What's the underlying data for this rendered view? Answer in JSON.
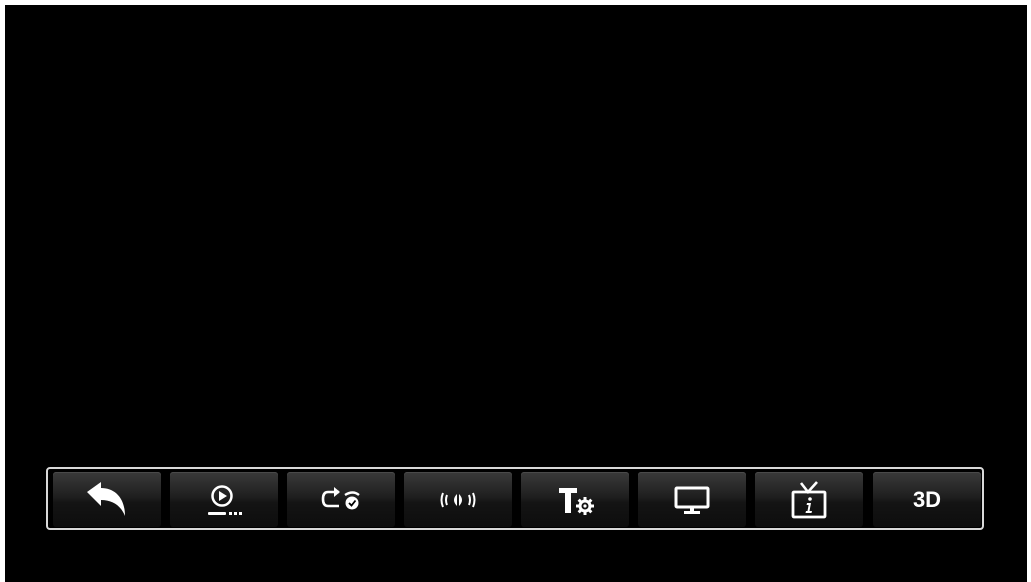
{
  "toolbar": {
    "buttons": [
      {
        "id": "back",
        "icon": "back-arrow-icon"
      },
      {
        "id": "play-mode",
        "icon": "play-progress-icon"
      },
      {
        "id": "repeat",
        "icon": "repeat-icon"
      },
      {
        "id": "audio",
        "icon": "audio-surround-icon"
      },
      {
        "id": "subtitle",
        "icon": "subtitle-settings-icon"
      },
      {
        "id": "display",
        "icon": "monitor-icon"
      },
      {
        "id": "info",
        "icon": "tv-info-icon"
      },
      {
        "id": "3d",
        "icon": "3d-icon",
        "label": "3D"
      }
    ],
    "colors": {
      "icon": "#ffffff",
      "border": "#d9d9d9",
      "background": "#000000"
    }
  }
}
